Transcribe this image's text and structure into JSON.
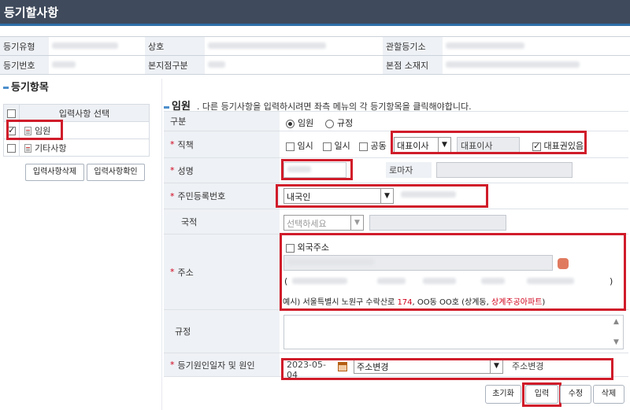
{
  "page": {
    "title": "등기할사항"
  },
  "info": {
    "labels": [
      "등기유형",
      "상호",
      "관할등기소",
      "등기번호",
      "본지점구분",
      "본점 소재지"
    ]
  },
  "left": {
    "section_title": "등기항목",
    "table_header": "입력사항 선택",
    "items": [
      {
        "label": "임원",
        "checked": true
      },
      {
        "label": "기타사항",
        "checked": false
      }
    ],
    "buttons": [
      "입력사항삭제",
      "입력사항확인"
    ]
  },
  "right": {
    "title": "임원",
    "hint": ". 다른 등기사항을 입력하시려면 좌측 메뉴의 각 등기항목을 클릭해야합니다."
  },
  "form": {
    "type": {
      "label": "구분",
      "options": [
        "임원",
        "규정"
      ],
      "selected": "임원"
    },
    "position": {
      "label": "직책",
      "checkboxes": [
        "임시",
        "일시",
        "공동"
      ],
      "select_value": "대표이사",
      "text_value": "대표이사",
      "rep_label": "대표권있음",
      "rep_checked": true
    },
    "name": {
      "label": "성명",
      "roman_label": "로마자"
    },
    "rrn": {
      "label": "주민등록번호",
      "select_value": "내국인"
    },
    "nationality": {
      "label": "국적",
      "select_placeholder": "선택하세요"
    },
    "address": {
      "label": "주소",
      "foreign_label": "외국주소",
      "bracket_open": "(",
      "bracket_close": ")",
      "example_prefix": "예시) 서울특별시 노원구 수락산로",
      "example_num": "174",
      "example_mid": ", OO동 OO호 (상계동,",
      "example_apt": "상계주공아파트",
      "example_end": ")"
    },
    "rule": {
      "label": "규정"
    },
    "cause": {
      "label": "등기원인일자 및 원인",
      "date_value": "2023-05-04",
      "select_value": "주소변경",
      "text_value": "주소변경"
    }
  },
  "actions": {
    "reset": "초기화",
    "input": "입력",
    "edit": "수정",
    "delete": "삭제"
  },
  "colors": {
    "header_bg": "#3f4a5c",
    "accent": "#4d8fcc",
    "highlight": "#d01c2a"
  }
}
